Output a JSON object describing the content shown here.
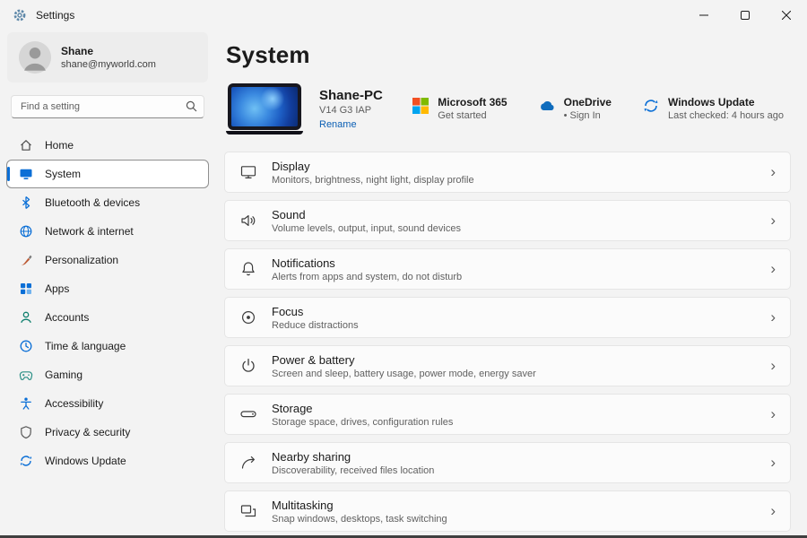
{
  "titlebar": {
    "app_title": "Settings"
  },
  "sidebar": {
    "user": {
      "name": "Shane",
      "email": "shane@myworld.com"
    },
    "search_placeholder": "Find a setting",
    "items": [
      {
        "label": "Home"
      },
      {
        "label": "System"
      },
      {
        "label": "Bluetooth & devices"
      },
      {
        "label": "Network & internet"
      },
      {
        "label": "Personalization"
      },
      {
        "label": "Apps"
      },
      {
        "label": "Accounts"
      },
      {
        "label": "Time & language"
      },
      {
        "label": "Gaming"
      },
      {
        "label": "Accessibility"
      },
      {
        "label": "Privacy & security"
      },
      {
        "label": "Windows Update"
      }
    ]
  },
  "main": {
    "page_title": "System",
    "device": {
      "name": "Shane-PC",
      "model": "V14 G3 IAP",
      "rename": "Rename"
    },
    "cards": [
      {
        "title": "Microsoft 365",
        "subtitle": "Get started"
      },
      {
        "title": "OneDrive",
        "subtitle": "• Sign In"
      },
      {
        "title": "Windows Update",
        "subtitle": "Last checked: 4 hours ago"
      }
    ],
    "settings": [
      {
        "title": "Display",
        "subtitle": "Monitors, brightness, night light, display profile"
      },
      {
        "title": "Sound",
        "subtitle": "Volume levels, output, input, sound devices"
      },
      {
        "title": "Notifications",
        "subtitle": "Alerts from apps and system, do not disturb"
      },
      {
        "title": "Focus",
        "subtitle": "Reduce distractions"
      },
      {
        "title": "Power & battery",
        "subtitle": "Screen and sleep, battery usage, power mode, energy saver"
      },
      {
        "title": "Storage",
        "subtitle": "Storage space, drives, configuration rules"
      },
      {
        "title": "Nearby sharing",
        "subtitle": "Discoverability, received files location"
      },
      {
        "title": "Multitasking",
        "subtitle": "Snap windows, desktops, task switching"
      }
    ],
    "chevron": "›"
  },
  "colors": {
    "accent": "#0b6fd6"
  }
}
